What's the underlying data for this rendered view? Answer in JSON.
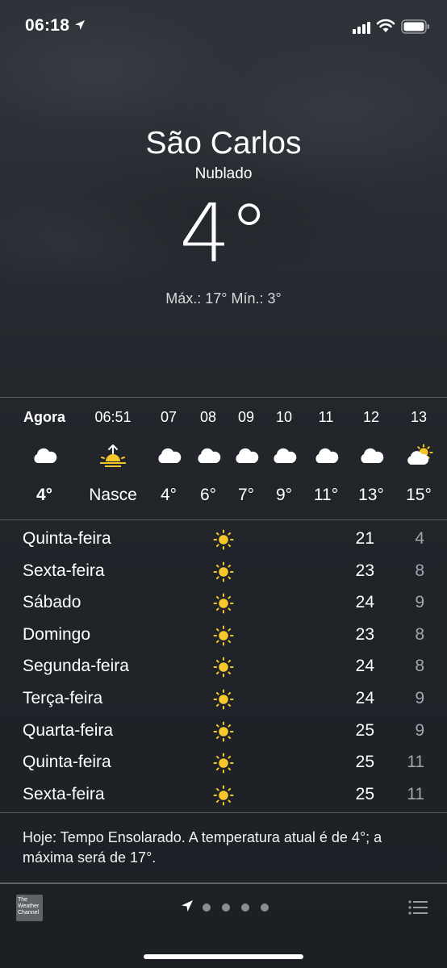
{
  "status_bar": {
    "time": "06:18"
  },
  "header": {
    "city": "São Carlos",
    "condition": "Nublado",
    "temperature": "4°",
    "high_low": "Máx.: 17° Mín.: 3°"
  },
  "hourly": [
    {
      "label": "Agora",
      "icon": "cloud-icon",
      "temp": "4°"
    },
    {
      "label": "06:51",
      "icon": "sunrise-icon",
      "temp": "Nasce"
    },
    {
      "label": "07",
      "icon": "cloud-icon",
      "temp": "4°"
    },
    {
      "label": "08",
      "icon": "cloud-icon",
      "temp": "6°"
    },
    {
      "label": "09",
      "icon": "cloud-icon",
      "temp": "7°"
    },
    {
      "label": "10",
      "icon": "cloud-icon",
      "temp": "9°"
    },
    {
      "label": "11",
      "icon": "cloud-icon",
      "temp": "11°"
    },
    {
      "label": "12",
      "icon": "cloud-icon",
      "temp": "13°"
    },
    {
      "label": "13",
      "icon": "partly-sunny-icon",
      "temp": "15°"
    }
  ],
  "daily": [
    {
      "day": "Quinta-feira",
      "icon": "sun-icon",
      "max": "21",
      "min": "4"
    },
    {
      "day": "Sexta-feira",
      "icon": "sun-icon",
      "max": "23",
      "min": "8"
    },
    {
      "day": "Sábado",
      "icon": "sun-icon",
      "max": "24",
      "min": "9"
    },
    {
      "day": "Domingo",
      "icon": "sun-icon",
      "max": "23",
      "min": "8"
    },
    {
      "day": "Segunda-feira",
      "icon": "sun-icon",
      "max": "24",
      "min": "8"
    },
    {
      "day": "Terça-feira",
      "icon": "sun-icon",
      "max": "24",
      "min": "9"
    },
    {
      "day": "Quarta-feira",
      "icon": "sun-icon",
      "max": "25",
      "min": "9"
    },
    {
      "day": "Quinta-feira",
      "icon": "sun-icon",
      "max": "25",
      "min": "11"
    },
    {
      "day": "Sexta-feira",
      "icon": "sun-icon",
      "max": "25",
      "min": "11"
    }
  ],
  "summary": "Hoje: Tempo Ensolarado. A temperatura atual é de 4°; a máxima será de 17°.",
  "footer": {
    "logo_text": "The Weather Channel",
    "page_count": 4
  },
  "colors": {
    "sun": "#f6c62d",
    "min_temp": "#a3a7ad",
    "background": "#22262b"
  }
}
